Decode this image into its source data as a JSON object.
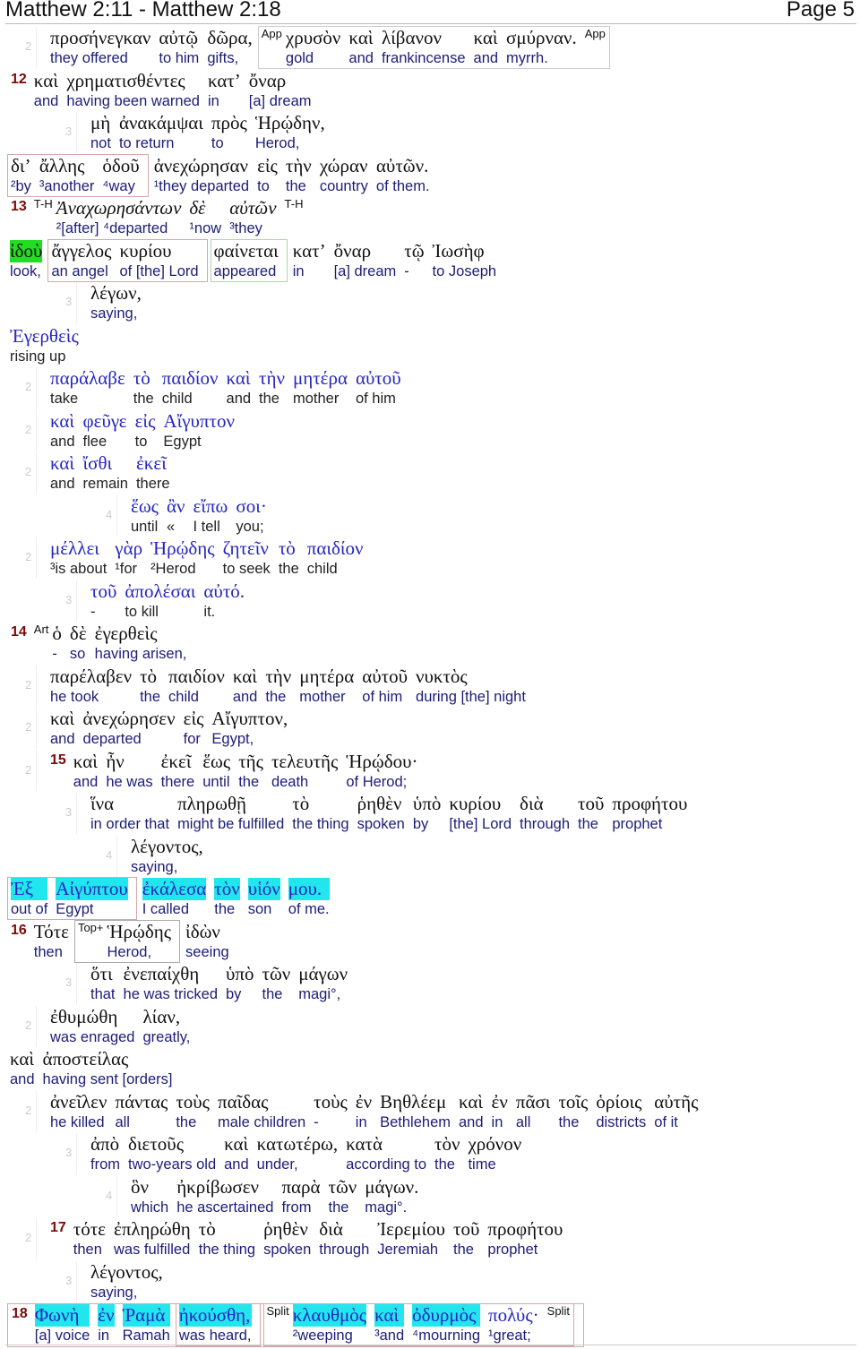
{
  "header": {
    "title": "Matthew 2:11 - Matthew 2:18",
    "page": "Page 5"
  },
  "colors": {
    "verse_number": "#7a0a0a",
    "greek": "#111111",
    "english": "#1c1c78",
    "speech_greek": "#2525c0",
    "highlight_green": "#22dd22",
    "highlight_cyan": "#22e6ee"
  },
  "lines": [
    {
      "lvl": "2",
      "words": [
        {
          "g": "προσήνεγκαν",
          "e": "they offered"
        },
        {
          "g": "αὐτῷ",
          "e": "to him"
        },
        {
          "g": "δῶρα,",
          "e": "gifts,"
        },
        {
          "group": true,
          "border": "#cccccc",
          "tag": "App",
          "end_tag": "App",
          "words": [
            {
              "g": "χρυσὸν",
              "e": "gold"
            },
            {
              "g": "καὶ",
              "e": "and"
            },
            {
              "g": "λίβανον",
              "e": "frankincense"
            },
            {
              "g": "καὶ",
              "e": "and"
            },
            {
              "g": "σμύρναν.",
              "e": "myrrh."
            }
          ]
        }
      ]
    },
    {
      "verse": "12",
      "words": [
        {
          "g": "καὶ",
          "e": "and"
        },
        {
          "g": "χρηματισθέντες",
          "e": "having been warned"
        },
        {
          "g": "κατ’",
          "e": "in"
        },
        {
          "g": "ὄναρ",
          "e": "[a] dream"
        }
      ]
    },
    {
      "lvl": "3",
      "words": [
        {
          "g": "μὴ",
          "e": "not"
        },
        {
          "g": "ἀνακάμψαι",
          "e": "to return"
        },
        {
          "g": "πρὸς",
          "e": "to"
        },
        {
          "g": "Ἡρῴδην,",
          "e": "Herod,"
        }
      ]
    },
    {
      "words": [
        {
          "group": true,
          "border": "#d2a8a8",
          "words": [
            {
              "g": "δι’",
              "e": "²by"
            },
            {
              "g": "ἄλλης",
              "e": "³another"
            },
            {
              "g": "ὁδοῦ",
              "e": "⁴way"
            }
          ]
        },
        {
          "g": "ἀνεχώρησαν",
          "e": "¹they departed"
        },
        {
          "g": "εἰς",
          "e": "to"
        },
        {
          "g": "τὴν",
          "e": "the"
        },
        {
          "g": "χώραν",
          "e": "country"
        },
        {
          "g": "αὐτῶν.",
          "e": "of them."
        }
      ]
    },
    {
      "verse": "13",
      "tag": "T-H",
      "end_tag": "T-H",
      "italic": true,
      "words": [
        {
          "g": "Ἀναχωρησάντων",
          "e": "²[after] ⁴departed"
        },
        {
          "g": "δὲ",
          "e": "¹now"
        },
        {
          "g": "αὐτῶν",
          "e": "³they"
        }
      ]
    },
    {
      "words": [
        {
          "g": "ἰδοὺ",
          "e": "look,",
          "hl": "green"
        },
        {
          "group": true,
          "border": "#d2a8a8",
          "words": [
            {
              "g": "ἄγγελος",
              "e": "an angel"
            },
            {
              "g": "κυρίου",
              "e": "of [the] Lord"
            }
          ]
        },
        {
          "group": true,
          "border": "#a8d8a8",
          "words": [
            {
              "g": "φαίνεται",
              "e": "appeared"
            }
          ]
        },
        {
          "g": "κατ’",
          "e": "in"
        },
        {
          "g": "ὄναρ",
          "e": "[a] dream"
        },
        {
          "g": "τῷ",
          "e": "-"
        },
        {
          "g": "Ἰωσὴφ",
          "e": "to Joseph"
        }
      ]
    },
    {
      "lvl": "3",
      "words": [
        {
          "g": "λέγων,",
          "e": "saying,"
        }
      ]
    },
    {
      "speech": true,
      "words": [
        {
          "g": "Ἐγερθεὶς",
          "e": "rising up"
        }
      ]
    },
    {
      "lvl": "2",
      "speech": true,
      "words": [
        {
          "g": "παράλαβε",
          "e": "take"
        },
        {
          "g": "τὸ",
          "e": "the"
        },
        {
          "g": "παιδίον",
          "e": "child"
        },
        {
          "g": "καὶ",
          "e": "and"
        },
        {
          "g": "τὴν",
          "e": "the"
        },
        {
          "g": "μητέρα",
          "e": "mother"
        },
        {
          "g": "αὐτοῦ",
          "e": "of him"
        }
      ]
    },
    {
      "lvl": "2",
      "speech": true,
      "words": [
        {
          "g": "καὶ",
          "e": "and"
        },
        {
          "g": "φεῦγε",
          "e": "flee"
        },
        {
          "g": "εἰς",
          "e": "to"
        },
        {
          "g": "Αἴγυπτον",
          "e": "Egypt"
        }
      ]
    },
    {
      "lvl": "2",
      "speech": true,
      "words": [
        {
          "g": "καὶ",
          "e": "and"
        },
        {
          "g": "ἴσθι",
          "e": "remain"
        },
        {
          "g": "ἐκεῖ",
          "e": "there"
        }
      ]
    },
    {
      "lvl": "4",
      "speech": true,
      "words": [
        {
          "g": "ἕως",
          "e": "until"
        },
        {
          "g": "ἂν",
          "e": "«"
        },
        {
          "g": "εἴπω",
          "e": "I tell"
        },
        {
          "g": "σοι·",
          "e": "you;"
        }
      ]
    },
    {
      "lvl": "2",
      "speech": true,
      "words": [
        {
          "g": "μέλλει",
          "e": "³is about"
        },
        {
          "g": "γὰρ",
          "e": "¹for"
        },
        {
          "g": "Ἡρῴδης",
          "e": "²Herod"
        },
        {
          "g": "ζητεῖν",
          "e": "to seek"
        },
        {
          "g": "τὸ",
          "e": "the"
        },
        {
          "g": "παιδίον",
          "e": "child"
        }
      ]
    },
    {
      "lvl": "3",
      "speech": true,
      "words": [
        {
          "g": "τοῦ",
          "e": "-"
        },
        {
          "g": "ἀπολέσαι",
          "e": "to kill"
        },
        {
          "g": "αὐτό.",
          "e": "it."
        }
      ]
    },
    {
      "verse": "14",
      "tag": "Art",
      "words": [
        {
          "g": "ὁ",
          "e": "-"
        },
        {
          "g": "δὲ",
          "e": "so"
        },
        {
          "g": "ἐγερθεὶς",
          "e": "having arisen,"
        }
      ]
    },
    {
      "lvl": "2",
      "words": [
        {
          "g": "παρέλαβεν",
          "e": "he took"
        },
        {
          "g": "τὸ",
          "e": "the"
        },
        {
          "g": "παιδίον",
          "e": "child"
        },
        {
          "g": "καὶ",
          "e": "and"
        },
        {
          "g": "τὴν",
          "e": "the"
        },
        {
          "g": "μητέρα",
          "e": "mother"
        },
        {
          "g": "αὐτοῦ",
          "e": "of him"
        },
        {
          "g": "νυκτὸς",
          "e": "during [the] night"
        }
      ]
    },
    {
      "lvl": "2",
      "words": [
        {
          "g": "καὶ",
          "e": "and"
        },
        {
          "g": "ἀνεχώρησεν",
          "e": "departed"
        },
        {
          "g": "εἰς",
          "e": "for"
        },
        {
          "g": "Αἴγυπτον,",
          "e": "Egypt,"
        }
      ]
    },
    {
      "lvl": "2",
      "verse": "15",
      "words": [
        {
          "g": "καὶ",
          "e": "and"
        },
        {
          "g": "ἦν",
          "e": "he was"
        },
        {
          "g": "ἐκεῖ",
          "e": "there"
        },
        {
          "g": "ἕως",
          "e": "until"
        },
        {
          "g": "τῆς",
          "e": "the"
        },
        {
          "g": "τελευτῆς",
          "e": "death"
        },
        {
          "g": "Ἡρῴδου·",
          "e": "of Herod;"
        }
      ]
    },
    {
      "lvl": "3",
      "words": [
        {
          "g": "ἵνα",
          "e": "in order that"
        },
        {
          "g": "πληρωθῇ",
          "e": "might be fulfilled"
        },
        {
          "g": "τὸ",
          "e": "the thing"
        },
        {
          "g": "ῥηθὲν",
          "e": "spoken"
        },
        {
          "g": "ὑπὸ",
          "e": "by"
        },
        {
          "g": "κυρίου",
          "e": "[the] Lord"
        },
        {
          "g": "διὰ",
          "e": "through"
        },
        {
          "g": "τοῦ",
          "e": "the"
        },
        {
          "g": "προφήτου",
          "e": "prophet"
        }
      ]
    },
    {
      "lvl": "4",
      "words": [
        {
          "g": "λέγοντος,",
          "e": "saying,"
        }
      ]
    },
    {
      "blue": true,
      "words": [
        {
          "group": true,
          "border": "#d2a8a8",
          "words": [
            {
              "g": "Ἐξ",
              "e": "out of",
              "hl": "cyan"
            },
            {
              "g": "Αἰγύπτου",
              "e": "Egypt",
              "hl": "cyan"
            }
          ]
        },
        {
          "g": "ἐκάλεσα",
          "e": "I called",
          "hl": "cyan"
        },
        {
          "g": "τὸν",
          "e": "the",
          "hl": "cyan"
        },
        {
          "g": "υἱόν",
          "e": "son",
          "hl": "cyan"
        },
        {
          "g": "μου.",
          "e": "of me.",
          "hl": "cyan"
        }
      ]
    },
    {
      "verse": "16",
      "words": [
        {
          "g": "Τότε",
          "e": "then"
        },
        {
          "group": true,
          "border": "#aaaaaa",
          "tag": "Top+",
          "words": [
            {
              "g": "Ἡρῴδης",
              "e": "Herod,"
            }
          ]
        },
        {
          "g": "ἰδὼν",
          "e": "seeing"
        }
      ]
    },
    {
      "lvl": "3",
      "words": [
        {
          "g": "ὅτι",
          "e": "that"
        },
        {
          "g": "ἐνεπαίχθη",
          "e": "he was tricked"
        },
        {
          "g": "ὑπὸ",
          "e": "by"
        },
        {
          "g": "τῶν",
          "e": "the"
        },
        {
          "g": "μάγων",
          "e": "magi°,"
        }
      ]
    },
    {
      "lvl": "2",
      "words": [
        {
          "g": "ἐθυμώθη",
          "e": "was enraged"
        },
        {
          "g": "λίαν,",
          "e": "greatly,"
        }
      ]
    },
    {
      "words": [
        {
          "g": "καὶ",
          "e": "and"
        },
        {
          "g": "ἀποστείλας",
          "e": "having sent [orders]"
        }
      ]
    },
    {
      "lvl": "2",
      "words": [
        {
          "g": "ἀνεῖλεν",
          "e": "he killed"
        },
        {
          "g": "πάντας",
          "e": "all"
        },
        {
          "g": "τοὺς",
          "e": "the"
        },
        {
          "g": "παῖδας",
          "e": "male children"
        },
        {
          "g": "τοὺς",
          "e": "-"
        },
        {
          "g": "ἐν",
          "e": "in"
        },
        {
          "g": "Βηθλέεμ",
          "e": "Bethlehem"
        },
        {
          "g": "καὶ",
          "e": "and"
        },
        {
          "g": "ἐν",
          "e": "in"
        },
        {
          "g": "πᾶσι",
          "e": "all"
        },
        {
          "g": "τοῖς",
          "e": "the"
        },
        {
          "g": "ὁρίοις",
          "e": "districts"
        },
        {
          "g": "αὐτῆς",
          "e": "of it"
        }
      ]
    },
    {
      "lvl": "3",
      "words": [
        {
          "g": "ἀπὸ",
          "e": "from"
        },
        {
          "g": "διετοῦς",
          "e": "two-years old"
        },
        {
          "g": "καὶ",
          "e": "and"
        },
        {
          "g": "κατωτέρω,",
          "e": "under,"
        },
        {
          "g": "κατὰ",
          "e": "according to"
        },
        {
          "g": "τὸν",
          "e": "the"
        },
        {
          "g": "χρόνον",
          "e": "time"
        }
      ]
    },
    {
      "lvl": "4",
      "words": [
        {
          "g": "ὃν",
          "e": "which"
        },
        {
          "g": "ἠκρίβωσεν",
          "e": "he ascertained"
        },
        {
          "g": "παρὰ",
          "e": "from"
        },
        {
          "g": "τῶν",
          "e": "the"
        },
        {
          "g": "μάγων.",
          "e": "magi°."
        }
      ]
    },
    {
      "lvl": "2",
      "verse": "17",
      "words": [
        {
          "g": "τότε",
          "e": "then"
        },
        {
          "g": "ἐπληρώθη",
          "e": "was fulfilled"
        },
        {
          "g": "τὸ",
          "e": "the thing"
        },
        {
          "g": "ῥηθὲν",
          "e": "spoken"
        },
        {
          "g": "διὰ",
          "e": "through"
        },
        {
          "g": "Ἰερεμίου",
          "e": "Jeremiah"
        },
        {
          "g": "τοῦ",
          "e": "the"
        },
        {
          "g": "προφήτου",
          "e": "prophet"
        }
      ]
    },
    {
      "lvl": "3",
      "words": [
        {
          "g": "λέγοντος,",
          "e": "saying,"
        }
      ]
    },
    {
      "verse": "18",
      "box": true,
      "blue": true,
      "words": [
        {
          "g": "Φωνὴ",
          "e": "[a] voice",
          "hl": "cyan"
        },
        {
          "g": "ἐν",
          "e": "in",
          "hl": "cyan"
        },
        {
          "g": "Ῥαμὰ",
          "e": "Ramah",
          "hl": "cyan"
        },
        {
          "group": true,
          "border": "#d2a8a8",
          "words": [
            {
              "g": "ἠκούσθη,",
              "e": "was heard,",
              "hl": "cyan"
            }
          ]
        },
        {
          "group": true,
          "border": "#d2a8a8",
          "tag": "Split",
          "end_tag": "Split",
          "words": [
            {
              "g": "κλαυθμὸς",
              "e": "²weeping",
              "hl": "cyan"
            },
            {
              "g": "καὶ",
              "e": "³and",
              "hl": "cyan"
            },
            {
              "g": "ὀδυρμὸς",
              "e": "⁴mourning",
              "hl": "cyan"
            },
            {
              "g": "πολύς·",
              "e": "¹great;"
            }
          ]
        }
      ]
    }
  ]
}
